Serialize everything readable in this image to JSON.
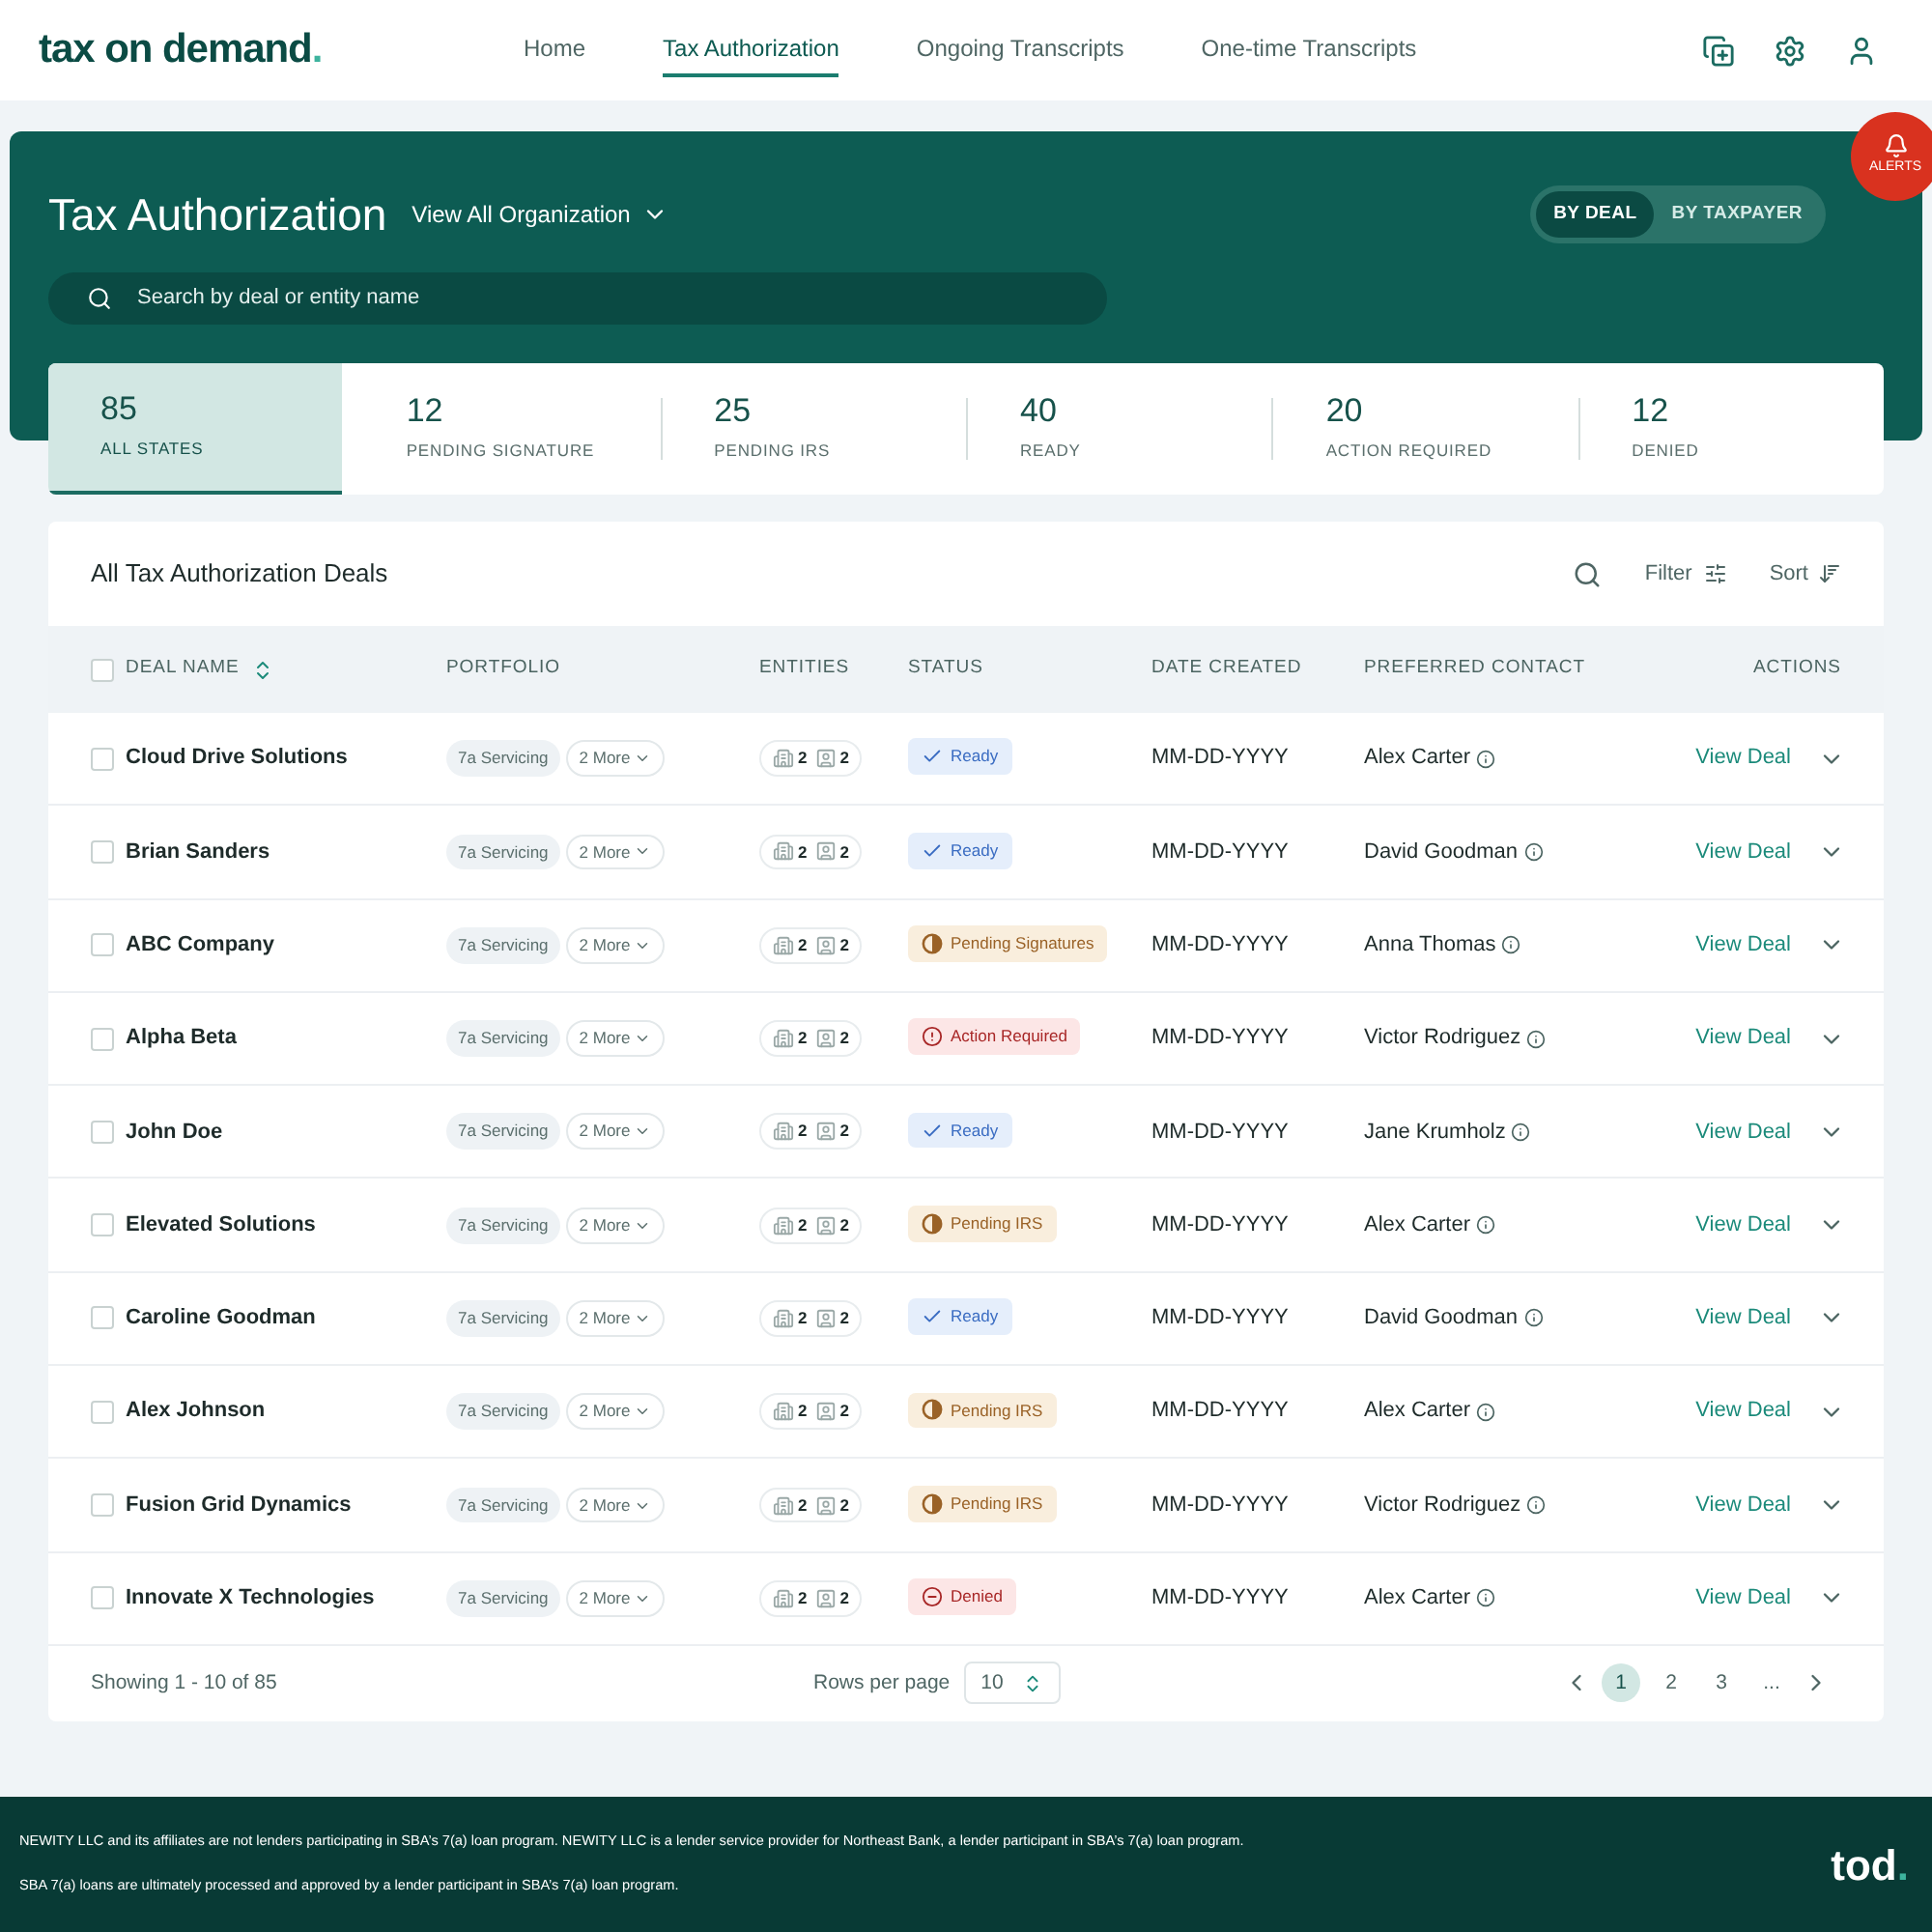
{
  "header": {
    "logo": "tax on demand",
    "logo_dot": ".",
    "nav": [
      {
        "label": "Home",
        "selected": false
      },
      {
        "label": "Tax Authorization",
        "selected": true
      },
      {
        "label": "Ongoing Transcripts",
        "selected": false
      },
      {
        "label": "One-time Transcripts",
        "selected": false
      }
    ]
  },
  "alerts": {
    "label": "ALERTS"
  },
  "banner": {
    "title": "Tax Authorization",
    "org_filter": "View All Organization",
    "search": {
      "placeholder": "Search by deal or entity name"
    },
    "toggle": [
      {
        "label": "BY DEAL",
        "selected": true
      },
      {
        "label": "BY TAXPAYER",
        "selected": false
      }
    ]
  },
  "stats": [
    {
      "count": "85",
      "label": "ALL STATES",
      "selected": true
    },
    {
      "count": "12",
      "label": "PENDING SIGNATURE",
      "selected": false
    },
    {
      "count": "25",
      "label": "PENDING IRS",
      "selected": false
    },
    {
      "count": "40",
      "label": "READY",
      "selected": false
    },
    {
      "count": "20",
      "label": "ACTION REQUIRED",
      "selected": false
    },
    {
      "count": "12",
      "label": "DENIED",
      "selected": false
    }
  ],
  "table": {
    "title": "All Tax Authorization Deals",
    "filter": "Filter",
    "sort": "Sort",
    "select_all": {
      "checked": false
    },
    "columns": [
      "DEAL NAME",
      "PORTFOLIO",
      "ENTITIES",
      "STATUS",
      "DATE CREATED",
      "PREFERRED CONTACT",
      "ACTIONS"
    ],
    "rows": [
      {
        "checked": false,
        "name": "Cloud Drive Solutions",
        "portfolio": "7a Servicing",
        "more": "2 More",
        "businesses": "2",
        "people": "2",
        "status": {
          "label": "Ready",
          "kind": "ready"
        },
        "date": "MM-DD-YYYY",
        "contact": "Alex Carter",
        "action": "View Deal"
      },
      {
        "checked": false,
        "name": "Brian Sanders",
        "portfolio": "7a Servicing",
        "more": "2 More",
        "businesses": "2",
        "people": "2",
        "status": {
          "label": "Ready",
          "kind": "ready"
        },
        "date": "MM-DD-YYYY",
        "contact": "David Goodman",
        "action": "View Deal"
      },
      {
        "checked": false,
        "name": "ABC Company",
        "portfolio": "7a Servicing",
        "more": "2 More",
        "businesses": "2",
        "people": "2",
        "status": {
          "label": "Pending Signatures",
          "kind": "pending"
        },
        "date": "MM-DD-YYYY",
        "contact": "Anna Thomas",
        "action": "View Deal"
      },
      {
        "checked": false,
        "name": "Alpha Beta",
        "portfolio": "7a Servicing",
        "more": "2 More",
        "businesses": "2",
        "people": "2",
        "status": {
          "label": "Action Required",
          "kind": "action"
        },
        "date": "MM-DD-YYYY",
        "contact": "Victor Rodriguez",
        "action": "View Deal"
      },
      {
        "checked": false,
        "name": "John Doe",
        "portfolio": "7a Servicing",
        "more": "2 More",
        "businesses": "2",
        "people": "2",
        "status": {
          "label": "Ready",
          "kind": "ready"
        },
        "date": "MM-DD-YYYY",
        "contact": "Jane Krumholz",
        "action": "View Deal"
      },
      {
        "checked": false,
        "name": "Elevated Solutions",
        "portfolio": "7a Servicing",
        "more": "2 More",
        "businesses": "2",
        "people": "2",
        "status": {
          "label": "Pending IRS",
          "kind": "pending"
        },
        "date": "MM-DD-YYYY",
        "contact": "Alex Carter",
        "action": "View Deal"
      },
      {
        "checked": false,
        "name": "Caroline Goodman",
        "portfolio": "7a Servicing",
        "more": "2 More",
        "businesses": "2",
        "people": "2",
        "status": {
          "label": "Ready",
          "kind": "ready"
        },
        "date": "MM-DD-YYYY",
        "contact": "David Goodman",
        "action": "View Deal"
      },
      {
        "checked": false,
        "name": "Alex Johnson",
        "portfolio": "7a Servicing",
        "more": "2 More",
        "businesses": "2",
        "people": "2",
        "status": {
          "label": "Pending IRS",
          "kind": "pending"
        },
        "date": "MM-DD-YYYY",
        "contact": "Alex Carter",
        "action": "View Deal"
      },
      {
        "checked": false,
        "name": "Fusion Grid Dynamics",
        "portfolio": "7a Servicing",
        "more": "2 More",
        "businesses": "2",
        "people": "2",
        "status": {
          "label": "Pending IRS",
          "kind": "pending"
        },
        "date": "MM-DD-YYYY",
        "contact": "Victor Rodriguez",
        "action": "View Deal"
      },
      {
        "checked": false,
        "name": "Innovate X Technologies",
        "portfolio": "7a Servicing",
        "more": "2 More",
        "businesses": "2",
        "people": "2",
        "status": {
          "label": "Denied",
          "kind": "denied"
        },
        "date": "MM-DD-YYYY",
        "contact": "Alex Carter",
        "action": "View Deal"
      }
    ],
    "showing": "Showing 1 - 10 of 85",
    "rows_per_page_label": "Rows per page",
    "rows_per_page": "10",
    "pages": [
      {
        "label": "1",
        "selected": true
      },
      {
        "label": "2",
        "selected": false
      },
      {
        "label": "3",
        "selected": false
      },
      {
        "label": "...",
        "selected": false
      }
    ]
  },
  "footer": {
    "lines": [
      "NEWITY LLC and its affiliates are not lenders participating in SBA’s 7(a) loan program. NEWITY LLC is a lender service provider for Northeast Bank, a lender participant in SBA’s 7(a) loan program.",
      "SBA 7(a) loans are ultimately processed and approved by a lender participant in SBA’s 7(a) loan program."
    ],
    "logo": "tod",
    "logo_dot": "."
  }
}
